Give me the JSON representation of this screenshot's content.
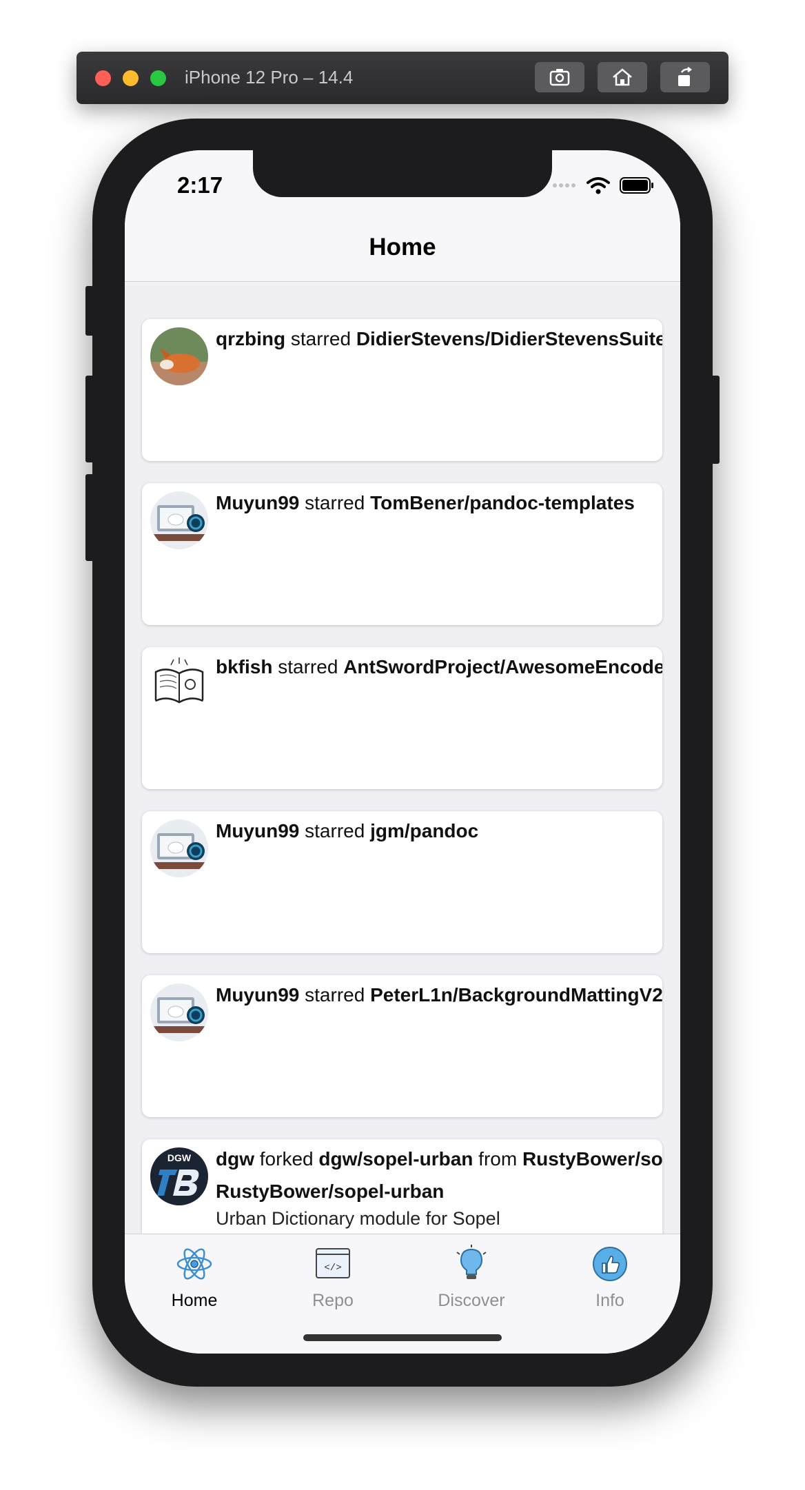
{
  "simulator": {
    "title": "iPhone 12 Pro – 14.4",
    "buttons": [
      "screenshot-icon",
      "home-icon",
      "rotate-icon"
    ]
  },
  "status_bar": {
    "time": "2:17",
    "icons": [
      "cellular-icon",
      "wifi-icon",
      "battery-icon"
    ]
  },
  "nav": {
    "title": "Home"
  },
  "feed": [
    {
      "actor": "qrzbing",
      "action": "starred",
      "repo": "DidierStevens/DidierStevensSuite",
      "avatar": "fox-avatar"
    },
    {
      "actor": "Muyun99",
      "action": "starred",
      "repo": "TomBener/pandoc-templates",
      "avatar": "laptop-avatar"
    },
    {
      "actor": "bkfish",
      "action": "starred",
      "repo": "AntSwordProject/AwesomeEncoder",
      "avatar": "book-avatar"
    },
    {
      "actor": "Muyun99",
      "action": "starred",
      "repo": "jgm/pandoc",
      "avatar": "laptop-avatar"
    },
    {
      "actor": "Muyun99",
      "action": "starred",
      "repo": "PeterL1n/BackgroundMattingV2",
      "avatar": "laptop-avatar"
    },
    {
      "actor": "dgw",
      "action": "forked",
      "repo": "dgw/sopel-urban",
      "connector": "from",
      "source": "RustyBower/sopel-urban",
      "sub_repo": "RustyBower/sopel-urban",
      "description": "Urban Dictionary module for Sopel",
      "avatar": "dgw-tb-avatar",
      "avatar_text": "DGW"
    }
  ],
  "tabs": [
    {
      "label": "Home",
      "icon": "atom-icon",
      "active": true
    },
    {
      "label": "Repo",
      "icon": "code-window-icon",
      "active": false
    },
    {
      "label": "Discover",
      "icon": "lightbulb-icon",
      "active": false
    },
    {
      "label": "Info",
      "icon": "thumbs-up-icon",
      "active": false
    }
  ],
  "colors": {
    "accent": "#4a9de0",
    "background": "#efeff4"
  }
}
